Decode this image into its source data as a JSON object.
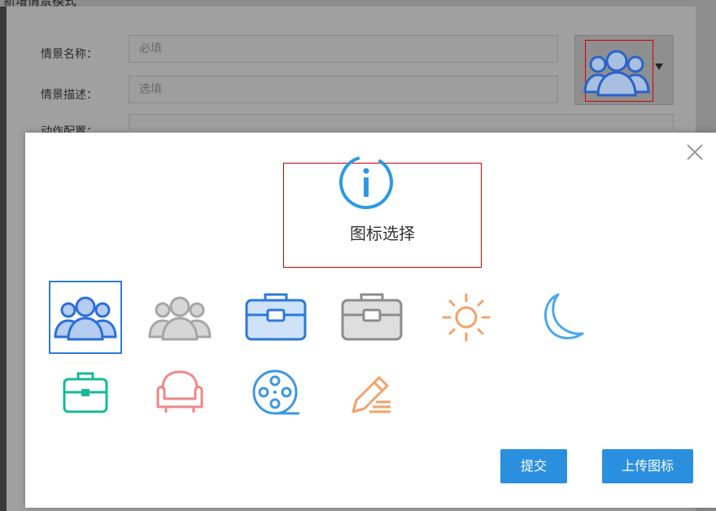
{
  "app": {
    "top_title": "新增情景模式"
  },
  "form": {
    "name_label": "情景名称：",
    "name_placeholder": "必填",
    "desc_label": "情景描述：",
    "desc_placeholder": "选填",
    "action_label": "动作配置："
  },
  "dialog": {
    "title": "图标选择",
    "submit_label": "提交",
    "upload_label": "上传图标",
    "icons": [
      {
        "name": "people-blue-icon",
        "color": "#2b6fd8",
        "selected": true
      },
      {
        "name": "people-gray-icon",
        "color": "#a6a6a6",
        "selected": false
      },
      {
        "name": "briefcase-blue-icon",
        "color": "#2b7ad8",
        "selected": false
      },
      {
        "name": "briefcase-gray-icon",
        "color": "#8c8c8c",
        "selected": false
      },
      {
        "name": "sun-icon",
        "color": "#f3a26a",
        "selected": false
      },
      {
        "name": "moon-icon",
        "color": "#4aa8ea",
        "selected": false
      },
      {
        "name": "toolbox-icon",
        "color": "#17b89a",
        "selected": false
      },
      {
        "name": "sofa-icon",
        "color": "#ee8787",
        "selected": false
      },
      {
        "name": "film-reel-icon",
        "color": "#3c98e0",
        "selected": false
      },
      {
        "name": "pencil-icon",
        "color": "#f3a26a",
        "selected": false
      }
    ]
  },
  "colors": {
    "accent": "#2b8fdf",
    "highlight": "#d00000"
  }
}
